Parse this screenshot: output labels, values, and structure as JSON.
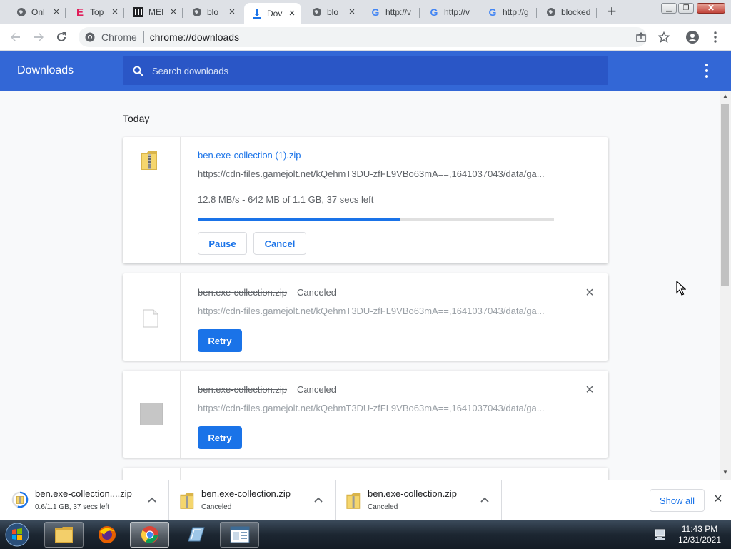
{
  "browser": {
    "tabs": [
      {
        "label": "Onl",
        "favicon": "globe-icon"
      },
      {
        "label": "Top",
        "favicon": "e-letter-icon"
      },
      {
        "label": "MEI",
        "favicon": "museum-icon"
      },
      {
        "label": "blo",
        "favicon": "globe-icon"
      },
      {
        "label": "Dov",
        "favicon": "download-icon",
        "active": true
      },
      {
        "label": "blo",
        "favicon": "globe-icon"
      },
      {
        "label": "http://v",
        "favicon": "google-g-icon"
      },
      {
        "label": "http://v",
        "favicon": "google-g-icon"
      },
      {
        "label": "http://g",
        "favicon": "google-g-icon"
      },
      {
        "label": "blocked",
        "favicon": "globe-icon"
      }
    ],
    "new_tab": "+",
    "omnibox": {
      "site": "Chrome",
      "url": "chrome://downloads"
    }
  },
  "downloads_page": {
    "title": "Downloads",
    "search_placeholder": "Search downloads",
    "section_label": "Today",
    "items": [
      {
        "filename": "ben.exe-collection (1).zip",
        "source": "https://cdn-files.gamejolt.net/kQehmT3DU-zfFL9VBo63mA==,1641037043/data/ga...",
        "progress_text": "12.8 MB/s - 642 MB of 1.1 GB, 37 secs left",
        "progress_fraction": 0.57,
        "buttons": [
          "Pause",
          "Cancel"
        ],
        "icon": "zip-folder-icon"
      },
      {
        "filename": "ben.exe-collection.zip",
        "status": "Canceled",
        "source": "https://cdn-files.gamejolt.net/kQehmT3DU-zfFL9VBo63mA==,1641037043/data/ga...",
        "button": "Retry",
        "icon": "blank-file-icon"
      },
      {
        "filename": "ben.exe-collection.zip",
        "status": "Canceled",
        "source": "https://cdn-files.gamejolt.net/kQehmT3DU-zfFL9VBo63mA==,1641037043/data/ga...",
        "button": "Retry",
        "icon": "gray-square-icon"
      }
    ]
  },
  "shelf": {
    "items": [
      {
        "name": "ben.exe-collection....zip",
        "status": "0.6/1.1 GB, 37 secs left",
        "icon": "zip-folder-icon",
        "progress_fraction": 0.55
      },
      {
        "name": "ben.exe-collection.zip",
        "status": "Canceled",
        "icon": "zip-folder-icon"
      },
      {
        "name": "ben.exe-collection.zip",
        "status": "Canceled",
        "icon": "zip-folder-icon"
      }
    ],
    "show_all": "Show all"
  },
  "taskbar": {
    "apps": [
      "explorer-icon",
      "firefox-icon",
      "chrome-icon",
      "notepad-icon",
      "window-icon"
    ],
    "time": "11:43 PM",
    "date": "12/31/2021"
  },
  "colors": {
    "accent": "#1a73e8",
    "header": "#3367d6",
    "search": "#2a56c6"
  }
}
